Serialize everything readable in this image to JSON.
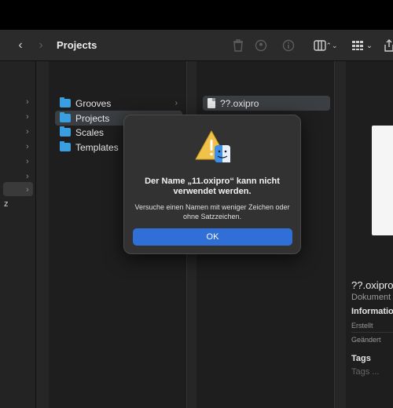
{
  "toolbar": {
    "back_glyph": "‹",
    "forward_glyph": "›",
    "title": "Projects",
    "view_glyph": "▥",
    "view_arrows": "⌃⌄",
    "group_glyph": "▦",
    "group_arrow": "⌄",
    "share_glyph": "⇧"
  },
  "sidebar_partial": {
    "chevron": "›",
    "cut_label": "z"
  },
  "column2": {
    "items": [
      {
        "label": "Grooves",
        "chevron": "›"
      },
      {
        "label": "Projects",
        "chevron": "›"
      },
      {
        "label": "Scales"
      },
      {
        "label": "Templates"
      }
    ]
  },
  "column3": {
    "items": [
      {
        "label": "??.oxipro"
      }
    ]
  },
  "preview": {
    "name": "??.oxipro",
    "kind": "Dokument -",
    "info_heading": "Information",
    "created_label": "Erstellt",
    "changed_label": "Geändert",
    "tags_heading": "Tags",
    "tags_placeholder": "Tags ..."
  },
  "dialog": {
    "title": "Der Name „11.oxipro“ kann nicht verwendet werden.",
    "message": "Versuche einen Namen mit weniger Zeichen oder ohne Satzzeichen.",
    "ok_label": "OK"
  },
  "colors": {
    "accent": "#2f6fd6",
    "folder": "#3a9fe0",
    "warning": "#f0c24a"
  }
}
